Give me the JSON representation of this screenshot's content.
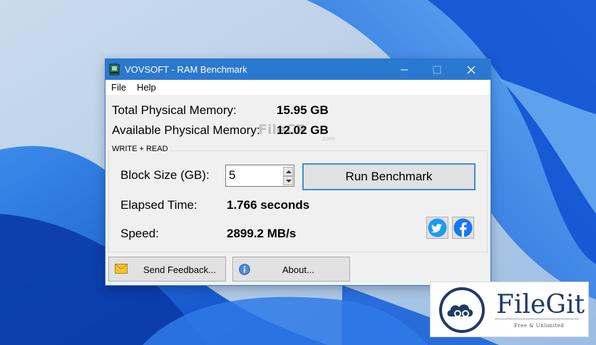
{
  "window": {
    "title": "VOVSOFT - RAM Benchmark",
    "accent_color": "#2b78d0"
  },
  "menu": {
    "file": "File",
    "help": "Help"
  },
  "memory": {
    "total_label": "Total Physical Memory:",
    "total_value": "15.95 GB",
    "available_label": "Available Physical Memory:",
    "available_value": "12.02 GB"
  },
  "benchmark": {
    "group_label": "WRITE + READ",
    "block_size_label": "Block Size (GB):",
    "block_size_value": "5",
    "run_button": "Run Benchmark",
    "elapsed_label": "Elapsed Time:",
    "elapsed_value": "1.766 seconds",
    "speed_label": "Speed:",
    "speed_value": "2899.2 MB/s"
  },
  "social": {
    "twitter_icon": "twitter-icon",
    "facebook_icon": "facebook-icon"
  },
  "footer": {
    "feedback_button": "Send Feedback...",
    "about_button": "About..."
  },
  "watermarks": {
    "small": "FileCR",
    "small_domain": ".com",
    "brand_name": "FileGit",
    "brand_tagline": "Free & Unlimited"
  }
}
